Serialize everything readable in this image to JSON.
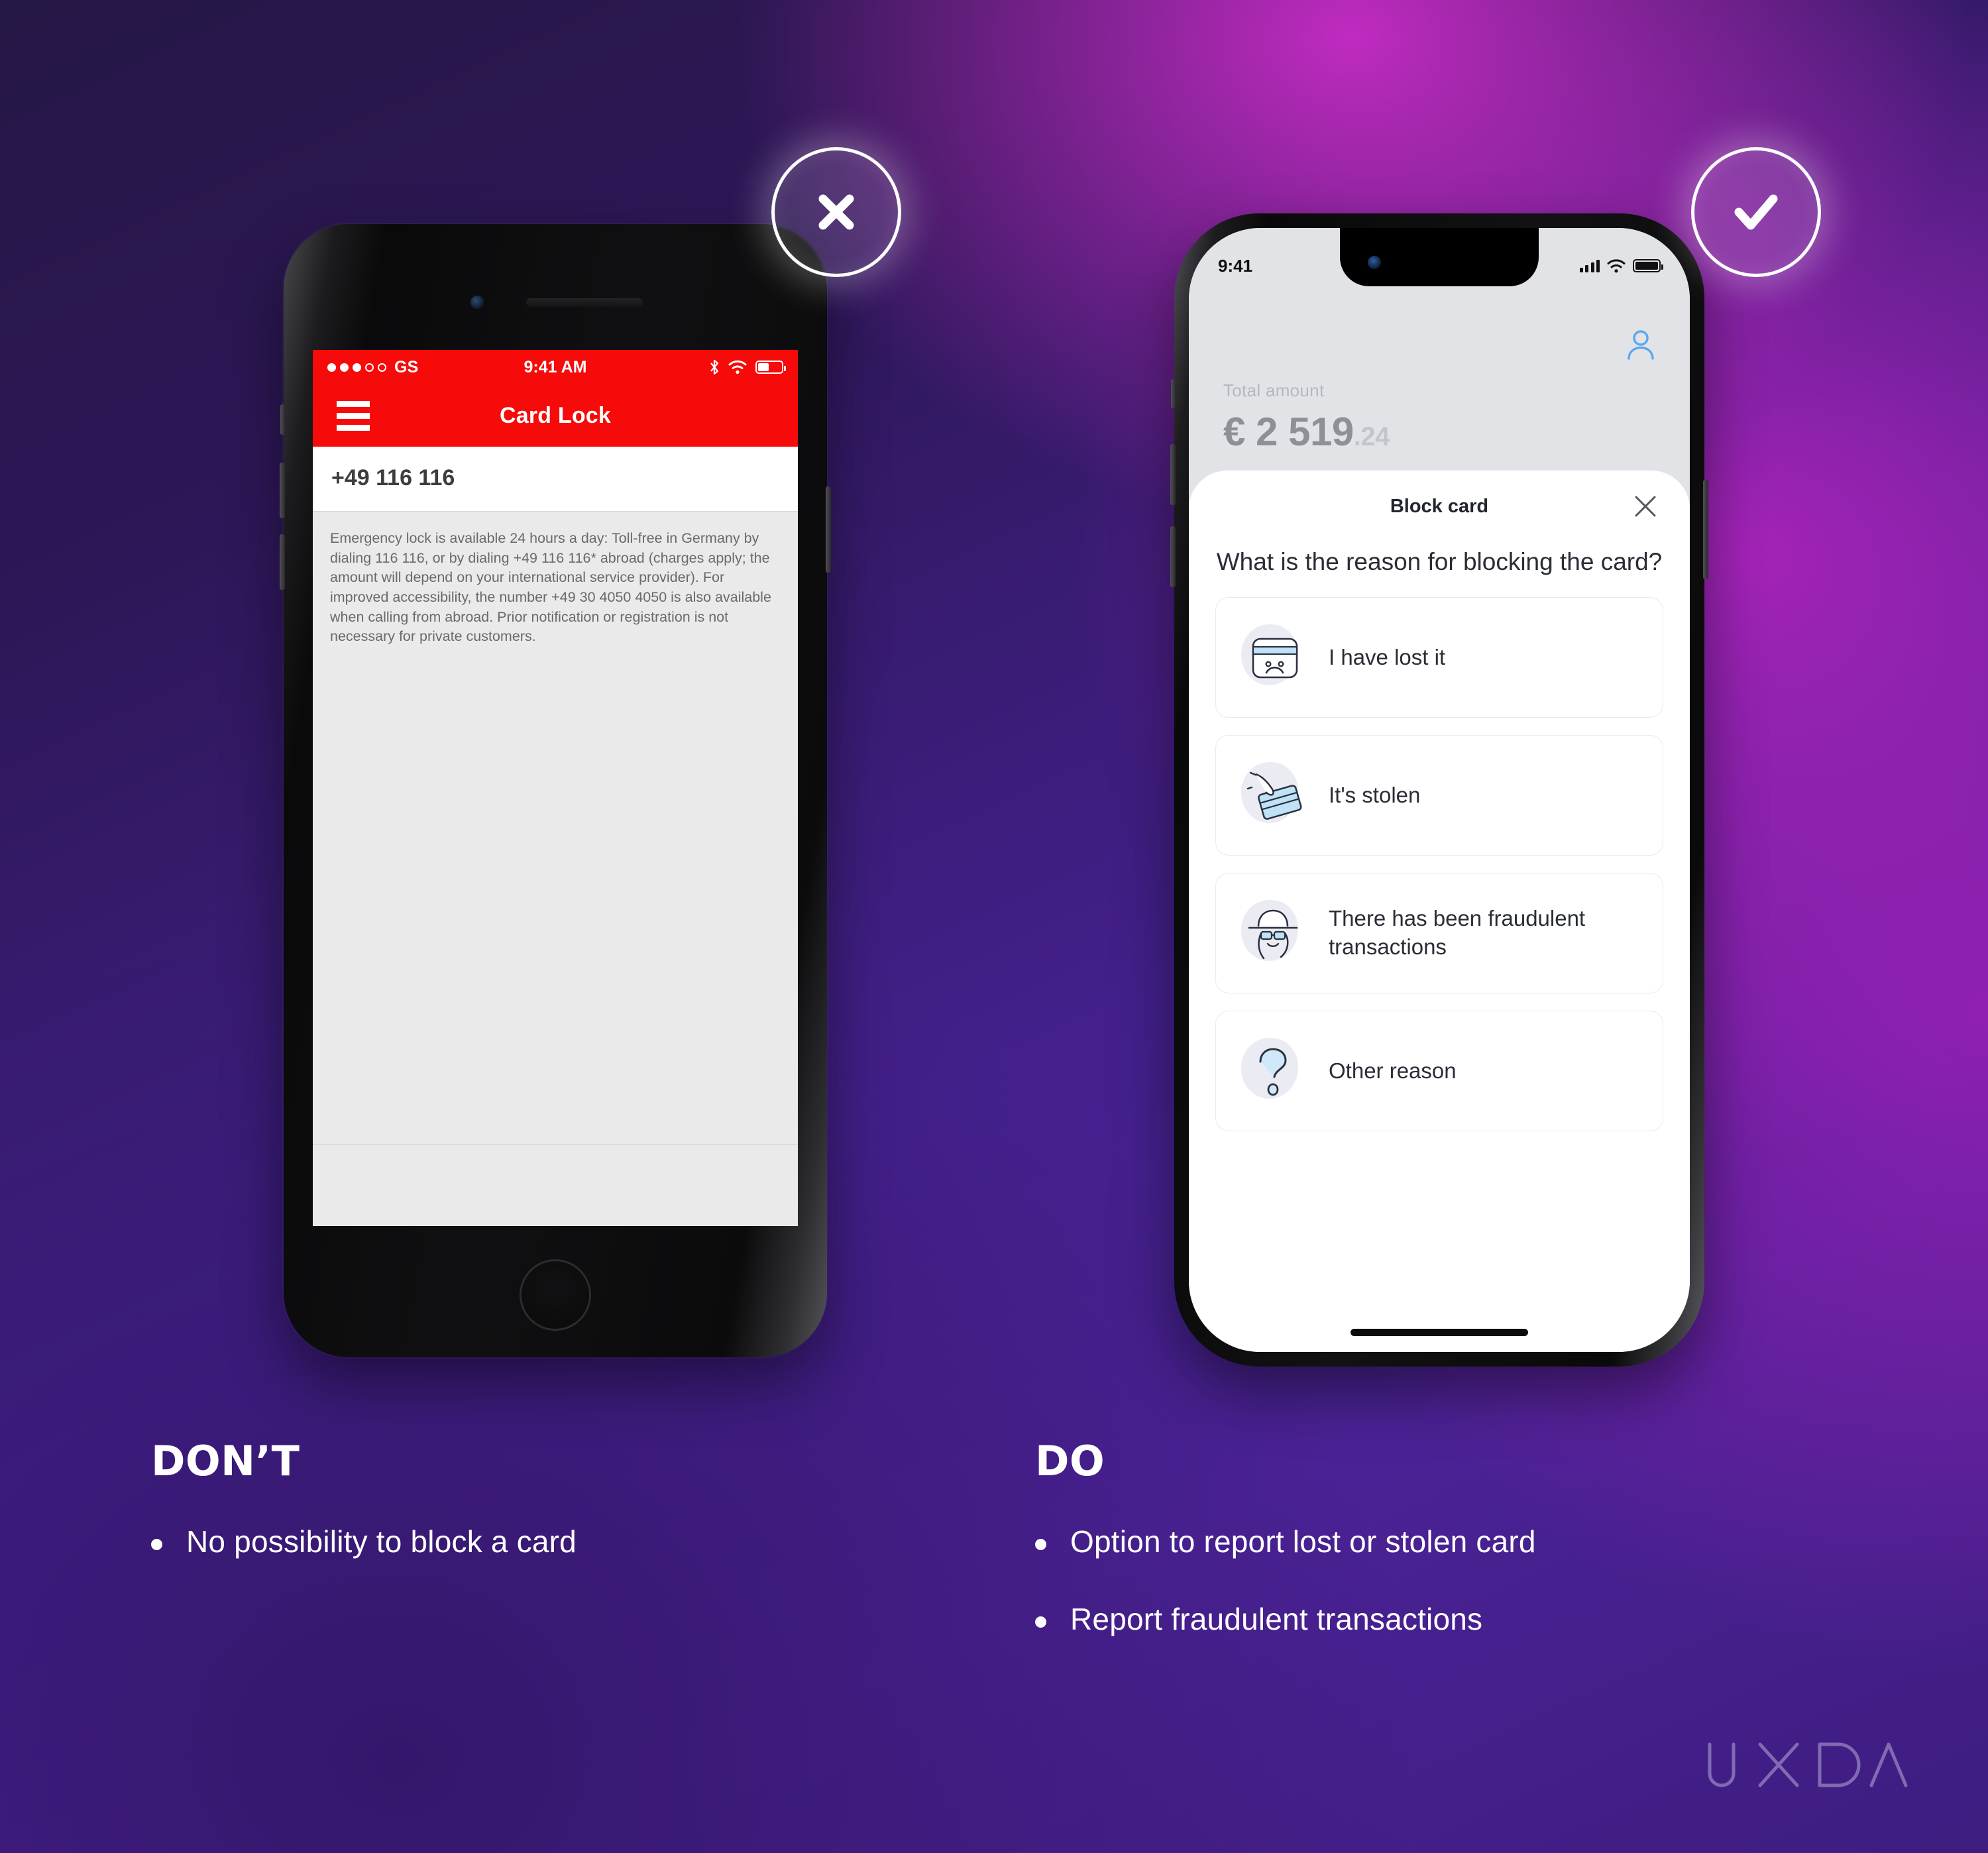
{
  "badges": {
    "dont_icon": "close-x-icon",
    "do_icon": "check-icon"
  },
  "old_phone": {
    "status": {
      "carrier": "GS",
      "time": "9:41 AM",
      "signal_dots_filled": 3,
      "signal_dots_total": 5,
      "icons": [
        "bluetooth-icon",
        "wifi-icon",
        "battery-icon"
      ],
      "battery_percent": 42
    },
    "navbar": {
      "menu_icon": "hamburger-menu-icon",
      "title": "Card Lock"
    },
    "phone_number": "+49 116 116",
    "body_text": "Emergency lock is available 24 hours a day: Toll-free in Germany by dialing 116 116, or by dialing +49 116 116* abroad (charges apply; the amount will depend on your international service provider). For improved accessibility, the number +49 30 4050 4050 is also available when calling from abroad. Prior notification or registration is not necessary for private customers."
  },
  "new_phone": {
    "status": {
      "time": "9:41",
      "icons": [
        "cellular-bars-icon",
        "wifi-icon",
        "battery-icon"
      ]
    },
    "account_icon": "person-avatar-icon",
    "amount_label": "Total amount",
    "amount_currency": "€",
    "amount_main": "2 519",
    "amount_cents": ".24",
    "sheet": {
      "title": "Block card",
      "close_icon": "close-x-icon",
      "question": "What is the reason for blocking the card?",
      "options": [
        {
          "label": "I have lost it",
          "icon": "sad-card-icon"
        },
        {
          "label": "It's stolen",
          "icon": "hand-stealing-card-icon"
        },
        {
          "label": "There has been fraudulent transactions",
          "icon": "spy-detective-icon"
        },
        {
          "label": "Other reason",
          "icon": "question-mark-icon"
        }
      ]
    }
  },
  "captions": {
    "dont": {
      "heading": "DON’T",
      "bullets": [
        "No possibility to block a card"
      ]
    },
    "do": {
      "heading": "DO",
      "bullets": [
        "Option to report lost or stolen card",
        "Report fraudulent transactions"
      ]
    }
  },
  "brand": {
    "logo_text": "UXDA"
  },
  "colors": {
    "accent_red": "#f70a0a",
    "badge_stroke": "#ffffff",
    "icon_blue": "#5aa9ef",
    "sheet_bg": "#ffffff"
  }
}
